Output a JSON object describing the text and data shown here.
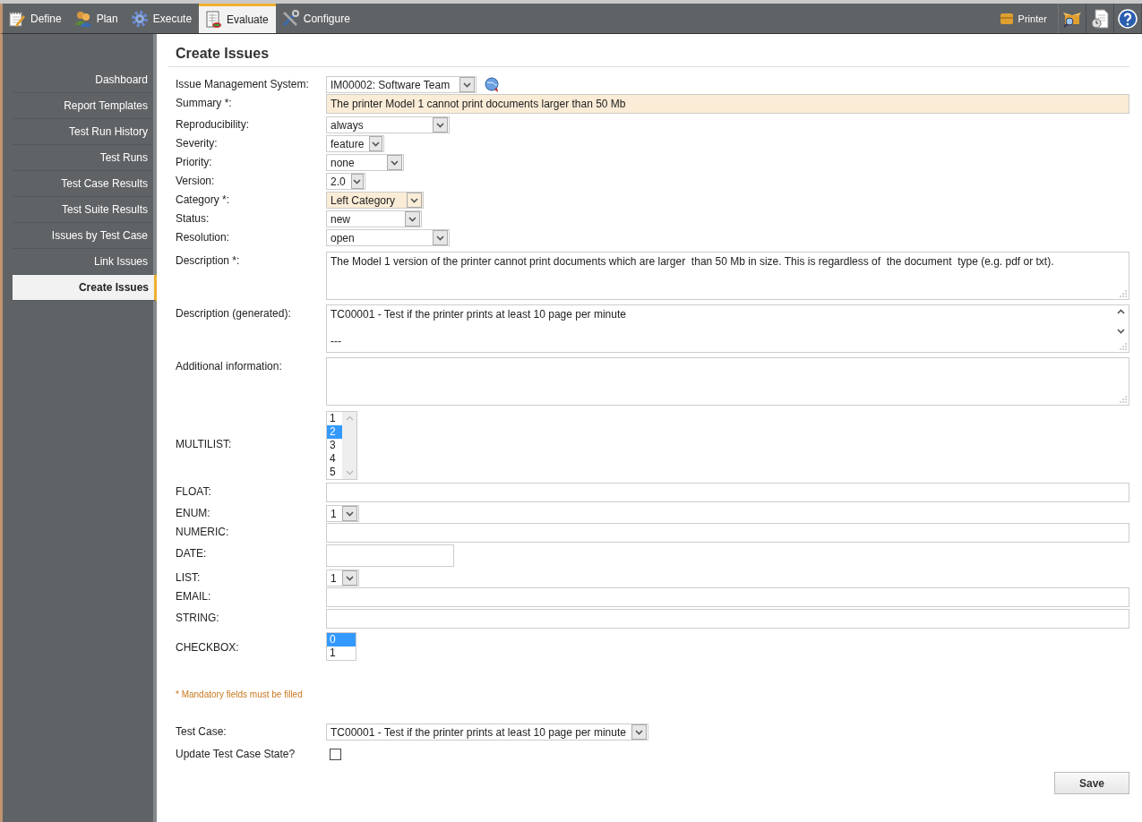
{
  "toolbar": {
    "tabs": [
      {
        "label": "Define",
        "selected": false
      },
      {
        "label": "Plan",
        "selected": false
      },
      {
        "label": "Execute",
        "selected": false
      },
      {
        "label": "Evaluate",
        "selected": true
      },
      {
        "label": "Configure",
        "selected": false
      }
    ],
    "project": "Printer"
  },
  "sidebar": {
    "items": [
      {
        "label": "Dashboard",
        "selected": false
      },
      {
        "label": "Report Templates",
        "selected": false
      },
      {
        "label": "Test Run History",
        "selected": false
      },
      {
        "label": "Test Runs",
        "selected": false
      },
      {
        "label": "Test Case Results",
        "selected": false
      },
      {
        "label": "Test Suite Results",
        "selected": false
      },
      {
        "label": "Issues by Test Case",
        "selected": false
      },
      {
        "label": "Link Issues",
        "selected": false
      },
      {
        "label": "Create Issues",
        "selected": true
      }
    ]
  },
  "form": {
    "title": "Create Issues",
    "fields": [
      {
        "kind": "lookup_select",
        "label": "Issue Management System:",
        "value": "IM00002: Software Team",
        "highlighted": false
      },
      {
        "kind": "text",
        "label": "Summary *:",
        "value": "The printer Model 1 cannot print documents larger than 50 Mb",
        "highlighted": true
      },
      {
        "kind": "select",
        "label": "Reproducibility:",
        "value": "always",
        "highlighted": false
      },
      {
        "kind": "select",
        "label": "Severity:",
        "value": "feature",
        "highlighted": false
      },
      {
        "kind": "select",
        "label": "Priority:",
        "value": "none",
        "highlighted": false
      },
      {
        "kind": "select",
        "label": "Version:",
        "value": "2.0",
        "highlighted": false
      },
      {
        "kind": "select",
        "label": "Category *:",
        "value": "Left Category",
        "highlighted": true
      },
      {
        "kind": "select",
        "label": "Status:",
        "value": "new",
        "highlighted": false
      },
      {
        "kind": "select",
        "label": "Resolution:",
        "value": "open",
        "highlighted": false
      },
      {
        "kind": "textarea",
        "label": "Description *:",
        "value": "The Model 1 version of the printer cannot print documents which are larger  than 50 Mb in size. This is regardless of  the document  type (e.g. pdf or txt).",
        "highlighted": false
      },
      {
        "kind": "scrolled_textarea",
        "label": "Description (generated):",
        "value": "TC00001 - Test if the printer prints at least 10 page per minute\n\n---",
        "highlighted": false
      },
      {
        "kind": "textarea",
        "label": "Additional information:",
        "highlighted": false
      },
      {
        "kind": "scrolled_listbox",
        "label": "MULTILIST:",
        "options": [
          {
            "label": "1",
            "selected": false
          },
          {
            "label": "2",
            "selected": true
          },
          {
            "label": "3",
            "selected": false
          },
          {
            "label": "4",
            "selected": false
          },
          {
            "label": "5",
            "selected": false
          }
        ],
        "highlighted": false
      },
      {
        "kind": "text",
        "label": "FLOAT:",
        "highlighted": false
      },
      {
        "kind": "select",
        "label": "ENUM:",
        "value": "1",
        "highlighted": false
      },
      {
        "kind": "text",
        "label": "NUMERIC:",
        "highlighted": false
      },
      {
        "kind": "date",
        "label": "DATE:",
        "highlighted": false
      },
      {
        "kind": "select",
        "label": "LIST:",
        "value": "1",
        "highlighted": false
      },
      {
        "kind": "text",
        "label": "EMAIL:",
        "highlighted": false
      },
      {
        "kind": "text",
        "label": "STRING:",
        "highlighted": false
      },
      {
        "kind": "listbox",
        "label": "CHECKBOX:",
        "options": [
          {
            "label": "0",
            "selected": true
          },
          {
            "label": "1",
            "selected": false
          }
        ],
        "highlighted": false
      }
    ],
    "note": "* Mandatory fields must be filled",
    "footer_fields": [
      {
        "kind": "select",
        "label": "Test Case:",
        "value": "TC00001 - Test if the printer prints at least 10 page per minute",
        "highlighted": false
      },
      {
        "kind": "checkbox",
        "label": "Update Test Case State?",
        "checked": false
      }
    ],
    "save": "Save"
  }
}
